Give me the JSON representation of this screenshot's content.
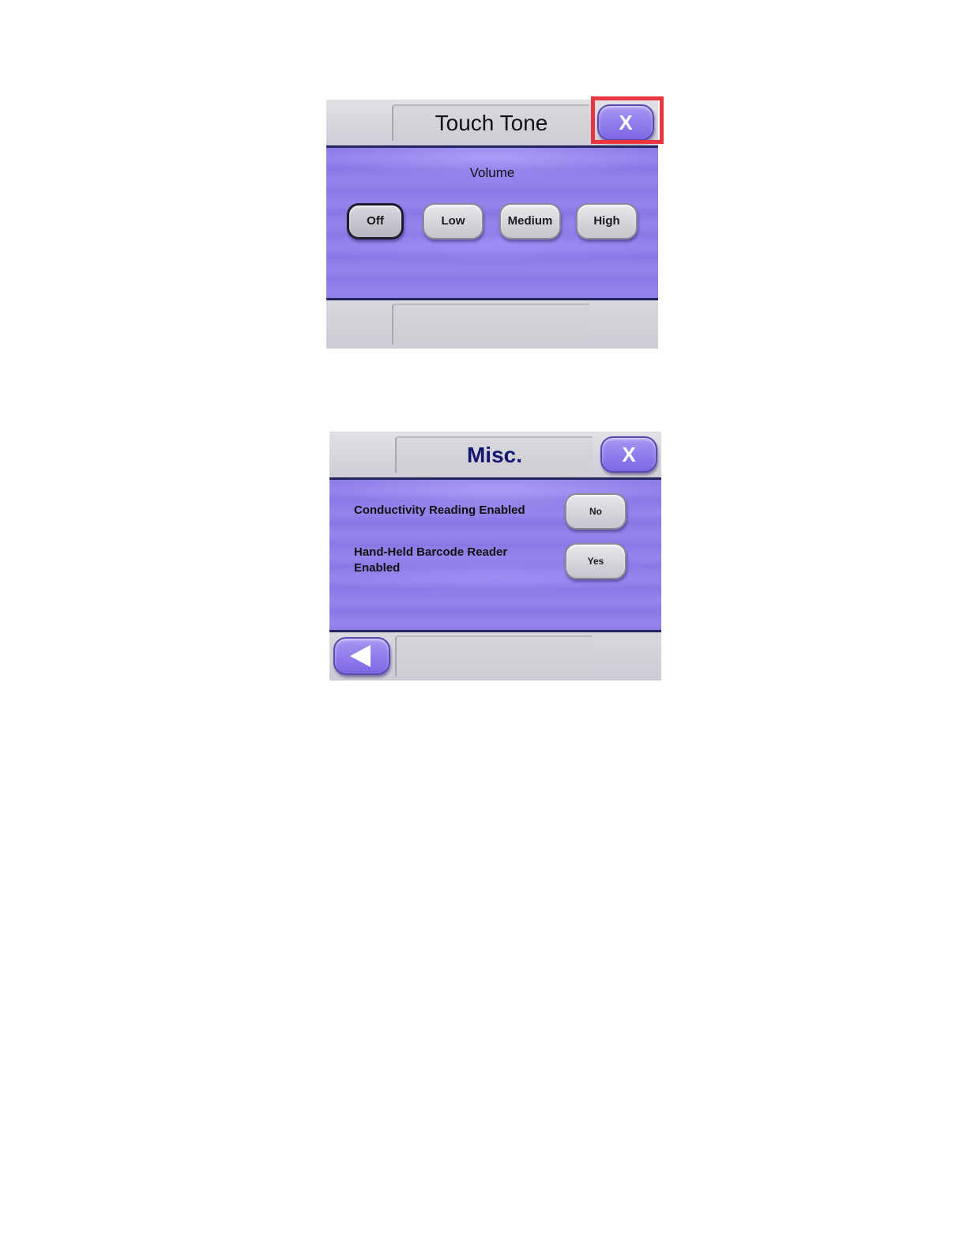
{
  "touch_tone": {
    "title": "Touch Tone",
    "close_label": "X",
    "volume_label": "Volume",
    "options": [
      "Off",
      "Low",
      "Medium",
      "High"
    ],
    "selected": "Off"
  },
  "misc": {
    "title": "Misc.",
    "close_label": "X",
    "settings": [
      {
        "label": "Conductivity Reading Enabled",
        "value": "No"
      },
      {
        "label": "Hand-Held Barcode Reader Enabled",
        "value": "Yes"
      }
    ]
  },
  "colors": {
    "accent_purple": "#8c79e6",
    "highlight_red": "#e8353f",
    "title_navy": "#14156e"
  },
  "icons": {
    "back": "left-triangle-arrow"
  }
}
